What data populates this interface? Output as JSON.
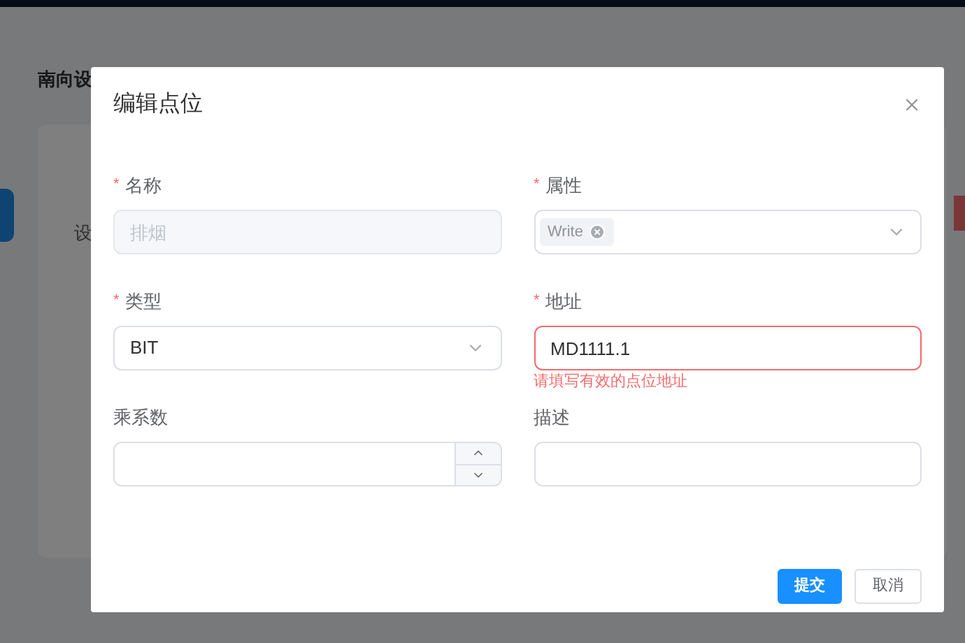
{
  "background": {
    "breadcrumb": "南向设",
    "card_text": "设"
  },
  "dialog": {
    "title": "编辑点位",
    "fields": [
      {
        "kind": "text",
        "label": "名称",
        "required_mark": "*",
        "placeholder": "排烟",
        "disabled": true
      },
      {
        "kind": "tags",
        "label": "属性",
        "required_mark": "*",
        "tags": [
          "Write"
        ]
      },
      {
        "kind": "select",
        "label": "类型",
        "required_mark": "*",
        "value": "BIT"
      },
      {
        "kind": "text",
        "label": "地址",
        "required_mark": "*",
        "value": "MD1111.1",
        "error": "请填写有效的点位地址"
      },
      {
        "kind": "number",
        "label": "乘系数"
      },
      {
        "kind": "text",
        "label": "描述"
      }
    ],
    "buttons": [
      {
        "label": "提交",
        "primary": true
      },
      {
        "label": "取消",
        "primary": false
      }
    ]
  }
}
